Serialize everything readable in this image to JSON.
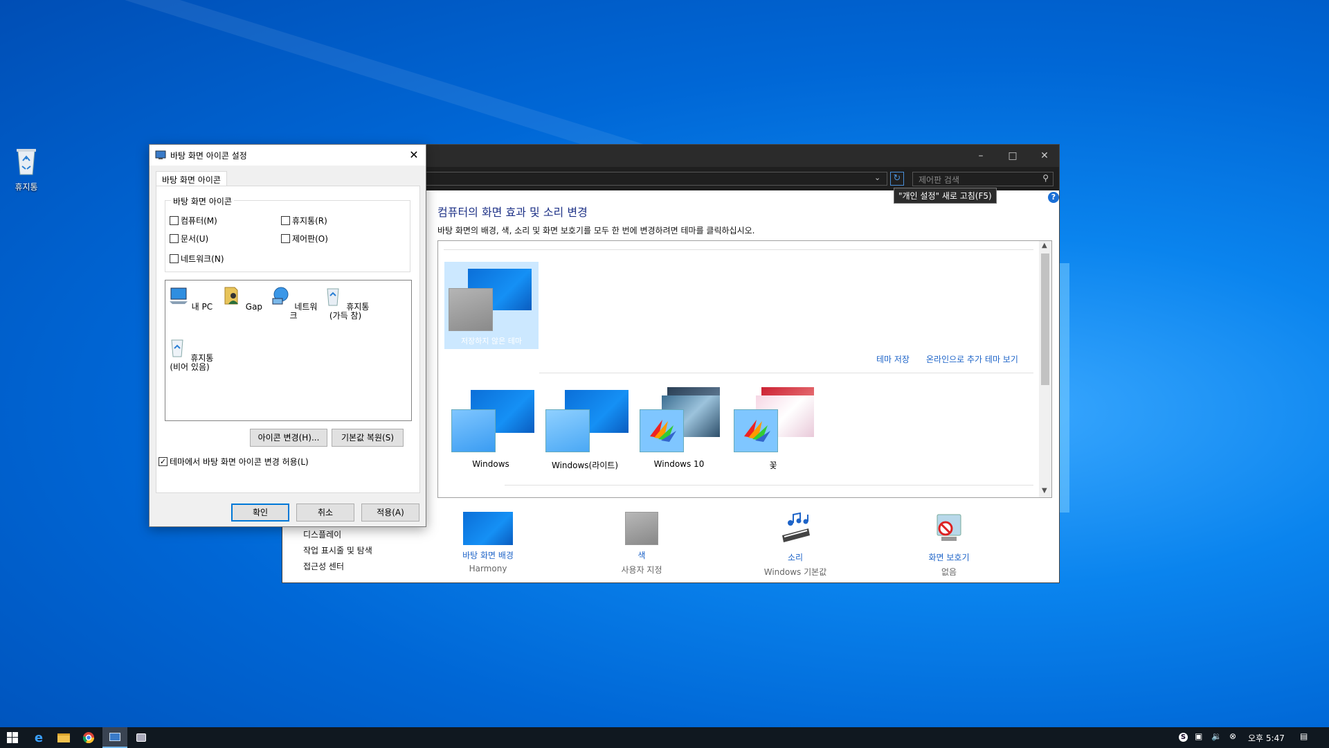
{
  "desktop": {
    "recycle_bin_label": "휴지통"
  },
  "control_panel": {
    "search_placeholder": "제어판 검색",
    "tooltip": "\"개인 설정\" 새로 고침(F5)",
    "heading": "컴퓨터의 화면 효과 및 소리 변경",
    "description": "바탕 화면의 배경, 색, 소리 및 화면 보호기를 모두 한 번에 변경하려면 테마를 클릭하십시오.",
    "unsaved_theme": "저장하지 않은 테마",
    "save_theme_link": "테마 저장",
    "more_themes_link": "온라인으로 추가 테마 보기",
    "themes": [
      {
        "label": "Windows"
      },
      {
        "label": "Windows(라이트)"
      },
      {
        "label": "Windows 10"
      },
      {
        "label": "꽃"
      }
    ],
    "left_links": [
      "디스플레이",
      "작업 표시줄 및 탐색",
      "접근성 센터"
    ],
    "bottom": [
      {
        "title": "바탕 화면 배경",
        "sub": "Harmony"
      },
      {
        "title": "색",
        "sub": "사용자 지정"
      },
      {
        "title": "소리",
        "sub": "Windows 기본값"
      },
      {
        "title": "화면 보호기",
        "sub": "없음"
      }
    ]
  },
  "dialog": {
    "title": "바탕 화면 아이콘 설정",
    "tab": "바탕 화면 아이콘",
    "group_label": "바탕 화면 아이콘",
    "checkboxes": {
      "computer": "컴퓨터(M)",
      "recycle": "휴지통(R)",
      "documents": "문서(U)",
      "control_panel": "제어판(O)",
      "network": "네트워크(N)"
    },
    "icons": [
      "내 PC",
      "Gap",
      "네트워크",
      "휴지통 (가득 참)",
      "휴지통 (비어 있음)"
    ],
    "change_icon": "아이콘 변경(H)...",
    "restore_default": "기본값 복원(S)",
    "allow_themes": "테마에서 바탕 화면 아이콘 변경 허용(L)",
    "allow_themes_checked": true,
    "ok": "확인",
    "cancel": "취소",
    "apply": "적용(A)"
  },
  "taskbar": {
    "time": "오후 5:47"
  }
}
